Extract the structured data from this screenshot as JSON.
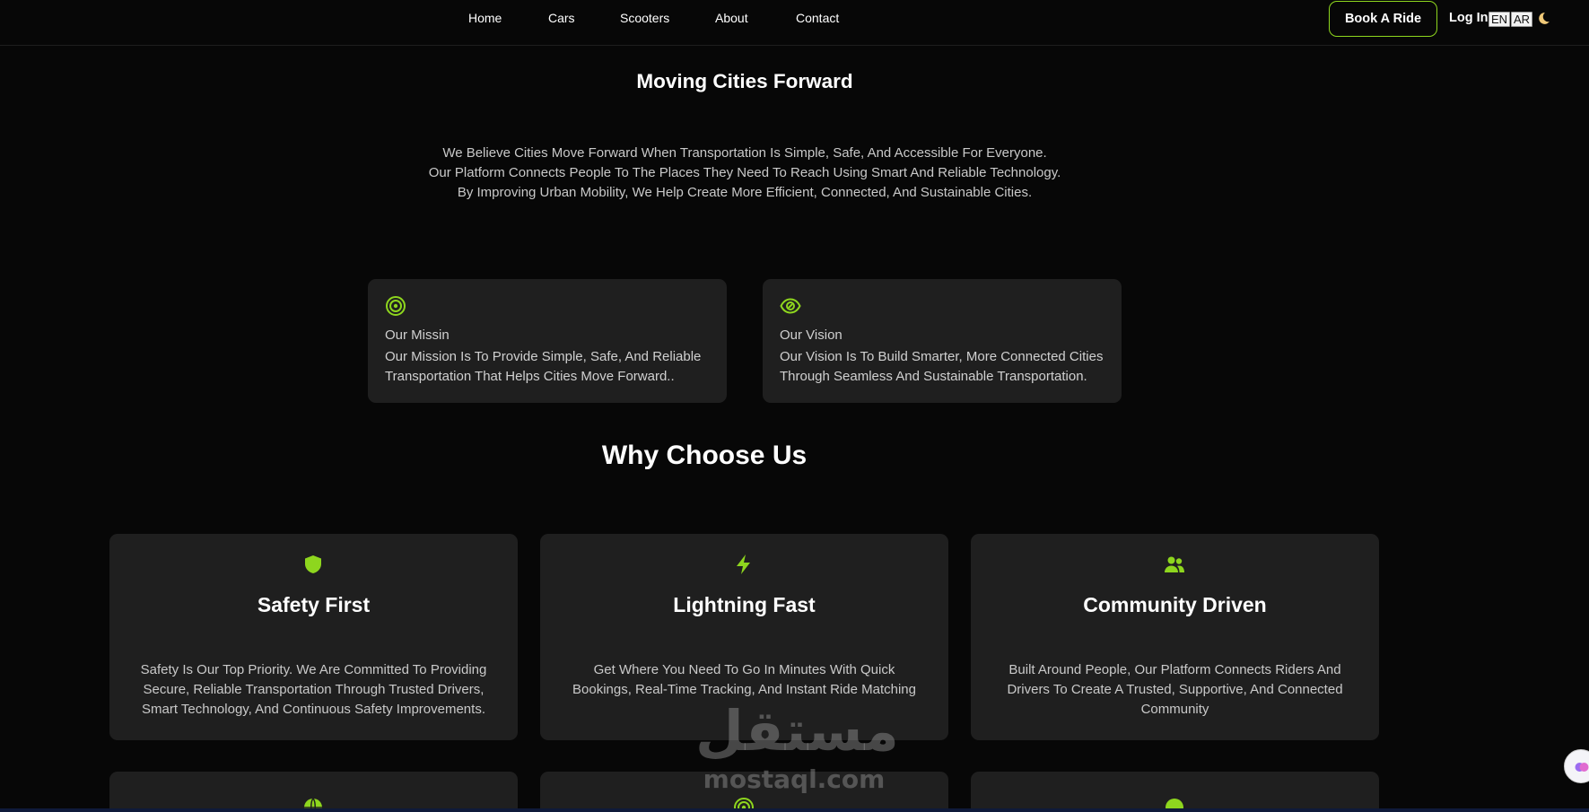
{
  "colors": {
    "accent": "#8ed61e",
    "background": "#070707",
    "card": "#1f1f1f"
  },
  "nav": {
    "links": [
      "Home",
      "Cars",
      "Scooters",
      "About",
      "Contact"
    ],
    "book_label": "Book A Ride",
    "login_label": "Log In",
    "lang_en": "EN",
    "lang_ar": "AR",
    "theme_icon": "moon-icon"
  },
  "about": {
    "title": "Moving Cities Forward",
    "lines": [
      "We Believe Cities Move Forward When Transportation Is Simple, Safe, And Accessible For Everyone.",
      "Our Platform Connects People To The Places They Need To Reach Using Smart And Reliable Technology.",
      "By Improving Urban Mobility, We Help Create More Efficient, Connected, And Sustainable Cities."
    ]
  },
  "mission": {
    "icon": "target-icon",
    "title": "Our Missin",
    "text": "Our Mission Is To Provide Simple, Safe, And Reliable Transportation That Helps Cities Move Forward.."
  },
  "vision": {
    "icon": "eye-icon",
    "title": "Our Vision",
    "text": "Our Vision Is To Build Smarter, More Connected Cities Through Seamless And Sustainable Transportation."
  },
  "why": {
    "title": "Why Choose Us",
    "features": [
      {
        "icon": "shield-icon",
        "title": "Safety First",
        "text": "Safety Is Our Top Priority. We Are Committed To Providing Secure, Reliable Transportation Through Trusted Drivers, Smart Technology, And Continuous Safety Improvements."
      },
      {
        "icon": "lightning-icon",
        "title": "Lightning Fast",
        "text": "Get Where You Need To Go In Minutes With Quick Bookings, Real-Time Tracking, And Instant Ride Matching"
      },
      {
        "icon": "users-icon",
        "title": "Community Driven",
        "text": "Built Around People, Our Platform Connects Riders And Drivers To Create A Trusted, Supportive, And Connected Community"
      }
    ],
    "row2_icons": [
      "globe-icon",
      "target-icon",
      "question-icon"
    ]
  },
  "watermark": {
    "arabic": "مستقل",
    "latin": "mostaql.com"
  }
}
